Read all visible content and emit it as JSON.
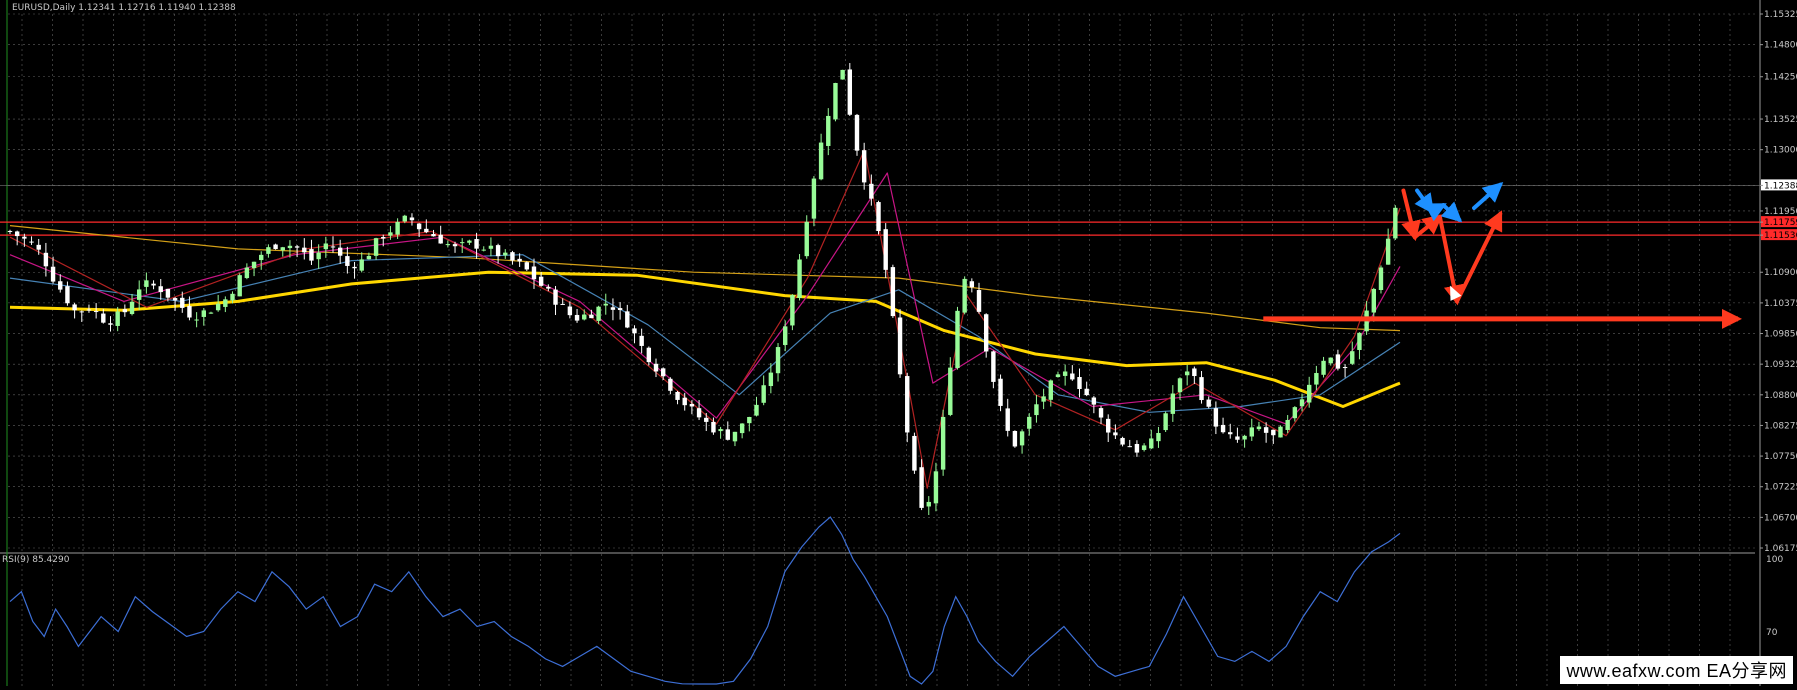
{
  "header": {
    "symbol_label": "EURUSD,Daily  1.12341 1.12716 1.11940 1.12388"
  },
  "rsi_label": "RSI(9) 85.4290",
  "watermark": "www.eafxw.com   EA分享网",
  "colors": {
    "bg": "#000000",
    "grid": "#8a8a8a",
    "bull": "#98fb98",
    "bear": "#ffffff",
    "ma_yellow": "#ffd700",
    "ma_orange": "#d4a017",
    "ma_red": "#b22222",
    "ma_magenta": "#c71585",
    "ma_blue": "#4682b4",
    "support_red": "#ff2a2a",
    "arrow_red": "#ff3a1f",
    "arrow_blue": "#1e90ff",
    "rsi_line": "#3d6fd6",
    "axis_text": "#c8c8c8"
  },
  "chart_data": [
    {
      "type": "candlestick",
      "title": "EURUSD,Daily",
      "ylim": [
        1.06175,
        1.15325
      ],
      "y_ticks": [
        1.15325,
        1.148,
        1.1425,
        1.13525,
        1.13,
        1.12388,
        1.1195,
        1.11759,
        1.11536,
        1.109,
        1.10375,
        1.0985,
        1.09325,
        1.088,
        1.08275,
        1.0775,
        1.07225,
        1.067,
        1.06175
      ],
      "y_tick_labels": [
        "1.15325",
        "1.14800",
        "1.14250",
        "1.13525",
        "1.13000",
        "1.12388",
        "1.11950",
        "1.11759",
        "1.11536",
        "1.10900",
        "1.10375",
        "1.09850",
        "1.09325",
        "1.08800",
        "1.08275",
        "1.07750",
        "1.07225",
        "1.06700",
        "1.06175"
      ],
      "highlighted_ticks": [
        {
          "label": "1.12388",
          "style": "white"
        },
        {
          "label": "1.11759",
          "style": "red"
        },
        {
          "label": "1.11536",
          "style": "red"
        }
      ],
      "horizontal_levels": [
        {
          "value": 1.11759,
          "color": "red"
        },
        {
          "value": 1.11536,
          "color": "red"
        }
      ],
      "last_price": 1.12388,
      "close_path": [
        [
          0,
          1.116
        ],
        [
          18,
          1.114
        ],
        [
          28,
          1.112
        ],
        [
          38,
          1.108
        ],
        [
          48,
          1.105
        ],
        [
          58,
          1.102
        ],
        [
          70,
          1.103
        ],
        [
          85,
          1.1005
        ],
        [
          100,
          1.102
        ],
        [
          115,
          1.107
        ],
        [
          130,
          1.1065
        ],
        [
          145,
          1.104
        ],
        [
          160,
          1.1015
        ],
        [
          175,
          1.1025
        ],
        [
          190,
          1.1045
        ],
        [
          205,
          1.109
        ],
        [
          220,
          1.112
        ],
        [
          235,
          1.114
        ],
        [
          250,
          1.1135
        ],
        [
          265,
          1.111
        ],
        [
          280,
          1.1145
        ],
        [
          295,
          1.11
        ],
        [
          310,
          1.111
        ],
        [
          325,
          1.115
        ],
        [
          340,
          1.117
        ],
        [
          350,
          1.1185
        ],
        [
          360,
          1.1165
        ],
        [
          375,
          1.115
        ],
        [
          390,
          1.113
        ],
        [
          405,
          1.114
        ],
        [
          420,
          1.113
        ],
        [
          435,
          1.1115
        ],
        [
          450,
          1.11
        ],
        [
          465,
          1.107
        ],
        [
          480,
          1.104
        ],
        [
          495,
          1.101
        ],
        [
          510,
          1.102
        ],
        [
          525,
          1.104
        ],
        [
          540,
          1.101
        ],
        [
          555,
          1.096
        ],
        [
          570,
          1.092
        ],
        [
          585,
          1.088
        ],
        [
          600,
          1.085
        ],
        [
          615,
          1.0825
        ],
        [
          630,
          1.081
        ],
        [
          645,
          1.083
        ],
        [
          660,
          1.088
        ],
        [
          675,
          1.096
        ],
        [
          690,
          1.108
        ],
        [
          705,
          1.125
        ],
        [
          720,
          1.138
        ],
        [
          730,
          1.145
        ],
        [
          740,
          1.133
        ],
        [
          750,
          1.125
        ],
        [
          760,
          1.118
        ],
        [
          770,
          1.108
        ],
        [
          780,
          1.093
        ],
        [
          790,
          1.078
        ],
        [
          800,
          1.068
        ],
        [
          810,
          1.071
        ],
        [
          820,
          1.085
        ],
        [
          830,
          1.101
        ],
        [
          840,
          1.11
        ],
        [
          850,
          1.103
        ],
        [
          860,
          1.093
        ],
        [
          870,
          1.085
        ],
        [
          880,
          1.079
        ],
        [
          890,
          1.082
        ],
        [
          900,
          1.086
        ],
        [
          915,
          1.09
        ],
        [
          930,
          1.092
        ],
        [
          945,
          1.088
        ],
        [
          960,
          1.083
        ],
        [
          975,
          1.08
        ],
        [
          990,
          1.0785
        ],
        [
          1005,
          1.08
        ],
        [
          1020,
          1.088
        ],
        [
          1035,
          1.093
        ],
        [
          1050,
          1.086
        ],
        [
          1065,
          1.081
        ],
        [
          1080,
          1.08
        ],
        [
          1095,
          1.0825
        ],
        [
          1110,
          1.0805
        ],
        [
          1125,
          1.084
        ],
        [
          1140,
          1.09
        ],
        [
          1155,
          1.095
        ],
        [
          1170,
          1.092
        ],
        [
          1185,
          1.0985
        ],
        [
          1200,
          1.108
        ],
        [
          1210,
          1.115
        ],
        [
          1220,
          1.1238
        ]
      ],
      "moving_averages": [
        {
          "color_key": "ma_yellow",
          "width": 3,
          "points": [
            [
              0,
              1.103
            ],
            [
              100,
              1.1025
            ],
            [
              200,
              1.104
            ],
            [
              300,
              1.107
            ],
            [
              420,
              1.109
            ],
            [
              550,
              1.1085
            ],
            [
              680,
              1.105
            ],
            [
              760,
              1.104
            ],
            [
              820,
              1.099
            ],
            [
              900,
              1.095
            ],
            [
              980,
              1.093
            ],
            [
              1050,
              1.0935
            ],
            [
              1110,
              1.0905
            ],
            [
              1170,
              1.086
            ],
            [
              1220,
              1.09
            ]
          ]
        },
        {
          "color_key": "ma_orange",
          "width": 1.2,
          "points": [
            [
              0,
              1.117
            ],
            [
              200,
              1.113
            ],
            [
              400,
              1.1115
            ],
            [
              600,
              1.109
            ],
            [
              780,
              1.108
            ],
            [
              900,
              1.105
            ],
            [
              1050,
              1.102
            ],
            [
              1150,
              1.0995
            ],
            [
              1220,
              1.099
            ]
          ]
        },
        {
          "color_key": "ma_blue",
          "width": 1.2,
          "points": [
            [
              0,
              1.108
            ],
            [
              150,
              1.104
            ],
            [
              300,
              1.111
            ],
            [
              450,
              1.112
            ],
            [
              560,
              1.1
            ],
            [
              640,
              1.088
            ],
            [
              720,
              1.102
            ],
            [
              780,
              1.106
            ],
            [
              850,
              1.098
            ],
            [
              920,
              1.088
            ],
            [
              1000,
              1.085
            ],
            [
              1080,
              1.086
            ],
            [
              1150,
              1.088
            ],
            [
              1220,
              1.097
            ]
          ]
        },
        {
          "color_key": "ma_magenta",
          "width": 1.2,
          "points": [
            [
              0,
              1.112
            ],
            [
              100,
              1.104
            ],
            [
              250,
              1.112
            ],
            [
              380,
              1.115
            ],
            [
              500,
              1.104
            ],
            [
              620,
              1.084
            ],
            [
              700,
              1.105
            ],
            [
              770,
              1.126
            ],
            [
              810,
              1.09
            ],
            [
              860,
              1.096
            ],
            [
              950,
              1.086
            ],
            [
              1050,
              1.088
            ],
            [
              1120,
              1.083
            ],
            [
              1180,
              1.096
            ],
            [
              1220,
              1.11
            ]
          ]
        },
        {
          "color_key": "ma_red",
          "width": 1.2,
          "points": [
            [
              0,
              1.115
            ],
            [
              120,
              1.103
            ],
            [
              260,
              1.113
            ],
            [
              370,
              1.116
            ],
            [
              500,
              1.103
            ],
            [
              620,
              1.083
            ],
            [
              700,
              1.108
            ],
            [
              750,
              1.13
            ],
            [
              805,
              1.072
            ],
            [
              840,
              1.105
            ],
            [
              900,
              1.088
            ],
            [
              970,
              1.082
            ],
            [
              1040,
              1.09
            ],
            [
              1120,
              1.081
            ],
            [
              1180,
              1.098
            ],
            [
              1220,
              1.12
            ]
          ]
        }
      ]
    },
    {
      "type": "line",
      "title": "RSI(9) 85.4290",
      "ylim": [
        0,
        100
      ],
      "y_ticks": [
        100,
        70
      ],
      "y_tick_labels": [
        "100",
        "70"
      ],
      "series": [
        {
          "values": [
            [
              0,
              58
            ],
            [
              10,
              62
            ],
            [
              20,
              50
            ],
            [
              30,
              44
            ],
            [
              40,
              55
            ],
            [
              50,
              48
            ],
            [
              60,
              40
            ],
            [
              70,
              46
            ],
            [
              80,
              52
            ],
            [
              95,
              46
            ],
            [
              110,
              60
            ],
            [
              125,
              54
            ],
            [
              140,
              49
            ],
            [
              155,
              44
            ],
            [
              170,
              46
            ],
            [
              185,
              55
            ],
            [
              200,
              62
            ],
            [
              215,
              58
            ],
            [
              230,
              70
            ],
            [
              245,
              64
            ],
            [
              260,
              55
            ],
            [
              275,
              60
            ],
            [
              290,
              48
            ],
            [
              305,
              52
            ],
            [
              320,
              65
            ],
            [
              335,
              62
            ],
            [
              350,
              70
            ],
            [
              365,
              60
            ],
            [
              380,
              52
            ],
            [
              395,
              55
            ],
            [
              410,
              48
            ],
            [
              425,
              50
            ],
            [
              440,
              44
            ],
            [
              455,
              40
            ],
            [
              470,
              35
            ],
            [
              485,
              32
            ],
            [
              500,
              36
            ],
            [
              515,
              40
            ],
            [
              530,
              35
            ],
            [
              545,
              30
            ],
            [
              560,
              28
            ],
            [
              575,
              26
            ],
            [
              590,
              25
            ],
            [
              605,
              24
            ],
            [
              620,
              22
            ],
            [
              635,
              26
            ],
            [
              650,
              35
            ],
            [
              665,
              48
            ],
            [
              680,
              70
            ],
            [
              695,
              80
            ],
            [
              710,
              88
            ],
            [
              720,
              92
            ],
            [
              730,
              85
            ],
            [
              740,
              75
            ],
            [
              750,
              68
            ],
            [
              760,
              60
            ],
            [
              770,
              52
            ],
            [
              780,
              40
            ],
            [
              790,
              28
            ],
            [
              800,
              20
            ],
            [
              810,
              30
            ],
            [
              820,
              48
            ],
            [
              830,
              60
            ],
            [
              840,
              52
            ],
            [
              850,
              42
            ],
            [
              865,
              34
            ],
            [
              880,
              28
            ],
            [
              895,
              36
            ],
            [
              910,
              42
            ],
            [
              925,
              48
            ],
            [
              940,
              40
            ],
            [
              955,
              32
            ],
            [
              970,
              28
            ],
            [
              985,
              30
            ],
            [
              1000,
              32
            ],
            [
              1015,
              45
            ],
            [
              1030,
              60
            ],
            [
              1045,
              48
            ],
            [
              1060,
              36
            ],
            [
              1075,
              34
            ],
            [
              1090,
              38
            ],
            [
              1105,
              34
            ],
            [
              1120,
              40
            ],
            [
              1135,
              52
            ],
            [
              1150,
              62
            ],
            [
              1165,
              58
            ],
            [
              1180,
              70
            ],
            [
              1195,
              78
            ],
            [
              1210,
              82
            ],
            [
              1220,
              85.429
            ]
          ]
        }
      ]
    }
  ],
  "annotations": {
    "red_arrows": [
      {
        "label": "down-1",
        "from": [
          1223,
          1.123
        ],
        "to": [
          1233,
          1.115
        ]
      },
      {
        "label": "up-1",
        "from": [
          1233,
          1.115
        ],
        "to": [
          1255,
          1.1185
        ]
      },
      {
        "label": "down-2",
        "from": [
          1255,
          1.1185
        ],
        "to": [
          1270,
          1.104
        ]
      },
      {
        "label": "up-2",
        "from": [
          1270,
          1.104
        ],
        "to": [
          1308,
          1.119
        ]
      }
    ],
    "blue_arrows": [
      {
        "label": "down-a",
        "from": [
          1235,
          1.123
        ],
        "to": [
          1248,
          1.1195
        ]
      },
      {
        "label": "up-a",
        "from": [
          1248,
          1.1195
        ],
        "to": [
          1258,
          1.1205
        ]
      },
      {
        "label": "down-b",
        "from": [
          1258,
          1.1205
        ],
        "to": [
          1272,
          1.118
        ]
      },
      {
        "label": "up-b",
        "from": [
          1285,
          1.12
        ],
        "to": [
          1308,
          1.124
        ]
      }
    ],
    "horizontal_arrow_level": 1.101
  }
}
